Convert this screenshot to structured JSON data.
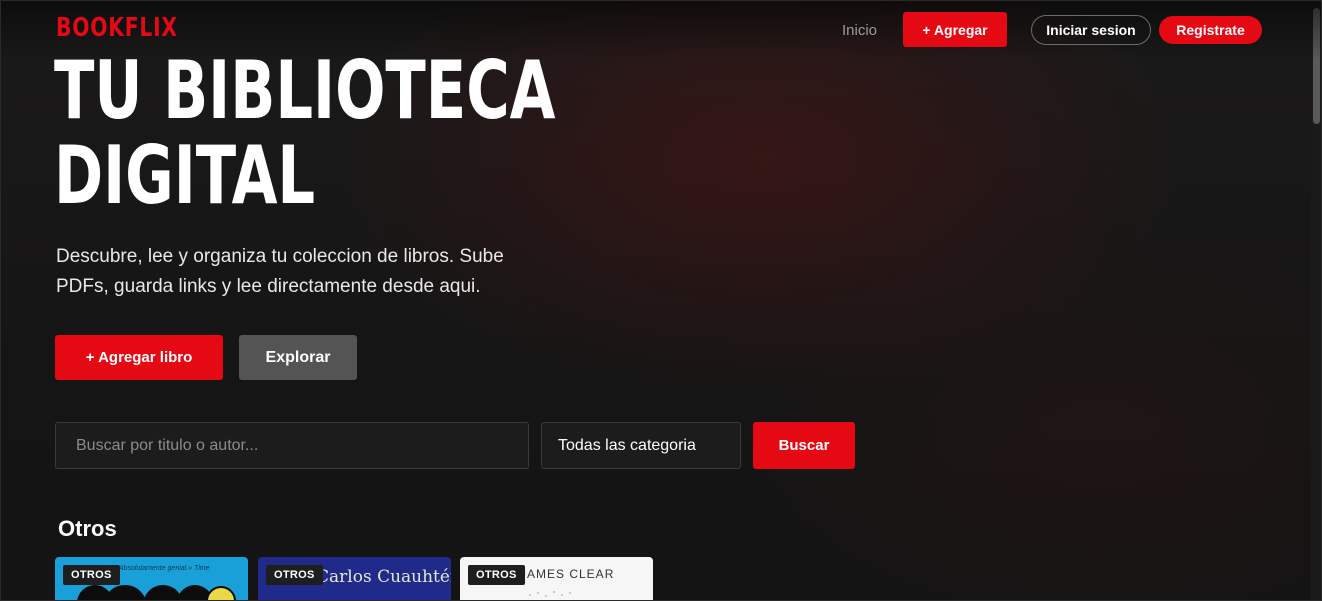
{
  "brand": {
    "name": "BOOKFLIX",
    "accent": "#e50914"
  },
  "nav": {
    "home_label": "Inicio",
    "add_label": "+ Agregar",
    "login_label": "Iniciar sesion",
    "register_label": "Registrate"
  },
  "hero": {
    "title_line1": "TU BIBLIOTECA",
    "title_line2": "DIGITAL",
    "description": "Descubre, lee y organiza tu coleccion de libros. Sube PDFs, guarda links y lee directamente desde aqui.",
    "primary_button": "+ Agregar libro",
    "secondary_button": "Explorar"
  },
  "search": {
    "placeholder": "Buscar por titulo o autor...",
    "category_selected": "Todas las categoria",
    "button_label": "Buscar"
  },
  "section": {
    "title": "Otros",
    "cards": [
      {
        "badge": "OTROS",
        "cover_text": "«Absolutamente genial.» Time",
        "color": "#1aa0d8"
      },
      {
        "badge": "OTROS",
        "cover_text": "Carlos Cuauhtémoc Sánchez",
        "color": "#1f2a8a"
      },
      {
        "badge": "OTROS",
        "cover_text": "JAMES CLEAR",
        "color": "#f6f6f6"
      }
    ]
  }
}
